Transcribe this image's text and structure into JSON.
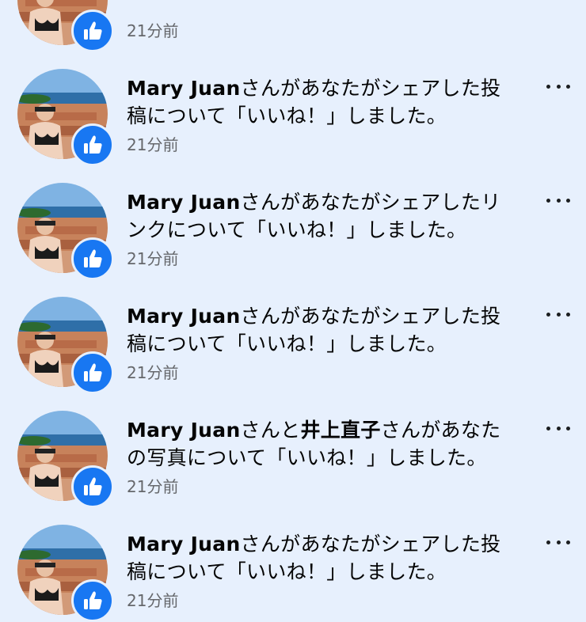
{
  "notifications": [
    {
      "actor": "",
      "actor2": "",
      "text_before": "",
      "text": "",
      "time": "21分前",
      "icons": {
        "avatar": "profile-photo",
        "badge": "thumbs-up-icon",
        "menu": "more-options-icon"
      }
    },
    {
      "actor": "Mary Juan",
      "actor2": "",
      "text_before": "",
      "text": "さんがあなたがシェアした投稿について「いいね！」しました。",
      "time": "21分前"
    },
    {
      "actor": "Mary Juan",
      "actor2": "",
      "text_before": "",
      "text": "さんがあなたがシェアしたリンクについて「いいね！」しました。",
      "time": "21分前"
    },
    {
      "actor": "Mary Juan",
      "actor2": "",
      "text_before": "",
      "text": "さんがあなたがシェアした投稿について「いいね！」しました。",
      "time": "21分前"
    },
    {
      "actor": "Mary Juan",
      "actor2": "井上直子",
      "text_before": "さんと",
      "text": "さんがあなたの写真について「いいね！」しました。",
      "time": "21分前"
    },
    {
      "actor": "Mary Juan",
      "actor2": "",
      "text_before": "",
      "text": "さんがあなたがシェアした投稿について「いいね！」しました。",
      "time": "21分前"
    }
  ],
  "colors": {
    "background": "#e7f0fd",
    "badge": "#1877f2",
    "time": "#65676b"
  }
}
